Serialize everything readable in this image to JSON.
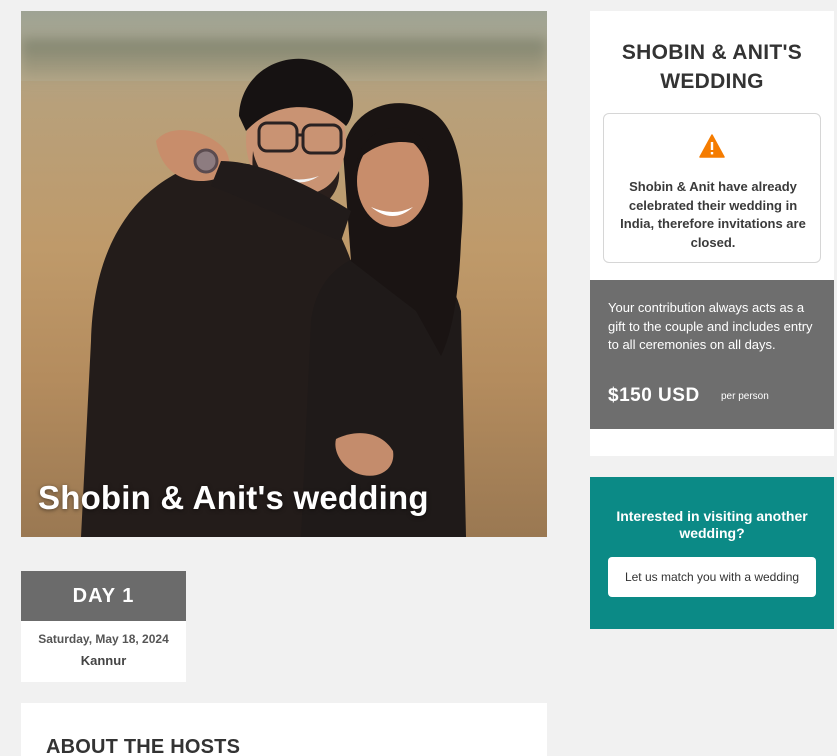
{
  "hero": {
    "caption": "Shobin & Anit's wedding"
  },
  "day": {
    "label": "DAY 1",
    "date": "Saturday, May 18, 2024",
    "location": "Kannur"
  },
  "about": {
    "heading": "ABOUT THE HOSTS"
  },
  "panel": {
    "title": "SHOBIN & ANIT'S WEDDING",
    "notice_icon": "warning-icon",
    "notice_text": "Shobin & Anit have already celebrated their wedding in India, therefore invitations are closed.",
    "contribution_text": "Your contribution always acts as a gift to the couple and includes entry to all ceremonies on all days.",
    "price": "$150 USD",
    "price_unit": "per person"
  },
  "match": {
    "heading": "Interested in visiting another wedding?",
    "button_label": "Let us match you with a wedding"
  },
  "colors": {
    "teal": "#0b8a86",
    "warning": "#f57c00",
    "dark_gray": "#6e6e6e"
  }
}
